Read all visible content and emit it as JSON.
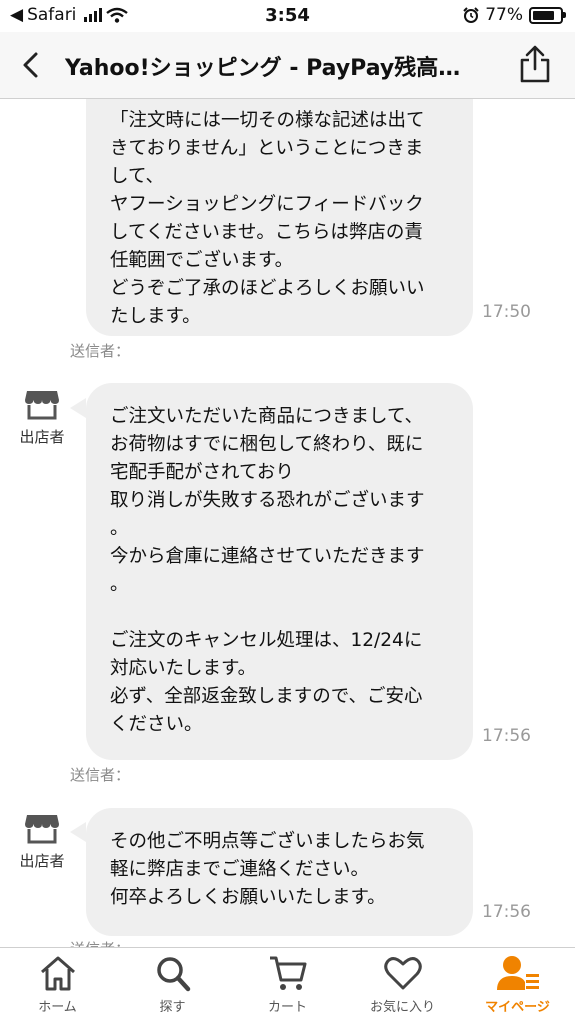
{
  "status_bar": {
    "back_app": "Safari",
    "time": "3:54",
    "battery": "77%"
  },
  "nav": {
    "title": "Yahoo!ショッピング - PayPay残高…"
  },
  "messages": [
    {
      "text": "「注文時には一切その様な記述は出て\nきておりません」ということにつきま\nして、\nヤフーショッピングにフィードバック\nしてくださいませ。こちらは弊店の責\n任範囲でございます。\nどうぞご了承のほどよろしくお願いい\nたします。",
      "time": "17:50",
      "sender": "送信者："
    },
    {
      "avatar_label": "出店者",
      "text": "ご注文いただいた商品につきまして、\nお荷物はすでに梱包して終わり、既に\n宅配手配がされており\n取り消しが失敗する恐れがございます\n。\n今から倉庫に連絡させていただきます\n。\n\nご注文のキャンセル処理は、12/24に\n対応いたします。\n必ず、全部返金致しますので、ご安心\nください。",
      "time": "17:56",
      "sender": "送信者："
    },
    {
      "avatar_label": "出店者",
      "text": "その他ご不明点等ございましたらお気\n軽に弊店までご連絡ください。\n何卒よろしくお願いいたします。",
      "time": "17:56",
      "sender": "送信者："
    }
  ],
  "tabbar": {
    "items": [
      {
        "label": "ホーム",
        "icon": "home-icon"
      },
      {
        "label": "探す",
        "icon": "search-icon"
      },
      {
        "label": "カート",
        "icon": "cart-icon"
      },
      {
        "label": "お気に入り",
        "icon": "heart-icon"
      },
      {
        "label": "マイページ",
        "icon": "person-icon"
      }
    ],
    "active_index": 4
  },
  "colors": {
    "accent": "#f08300",
    "bubble": "#efefef",
    "icon_gray": "#444444"
  }
}
